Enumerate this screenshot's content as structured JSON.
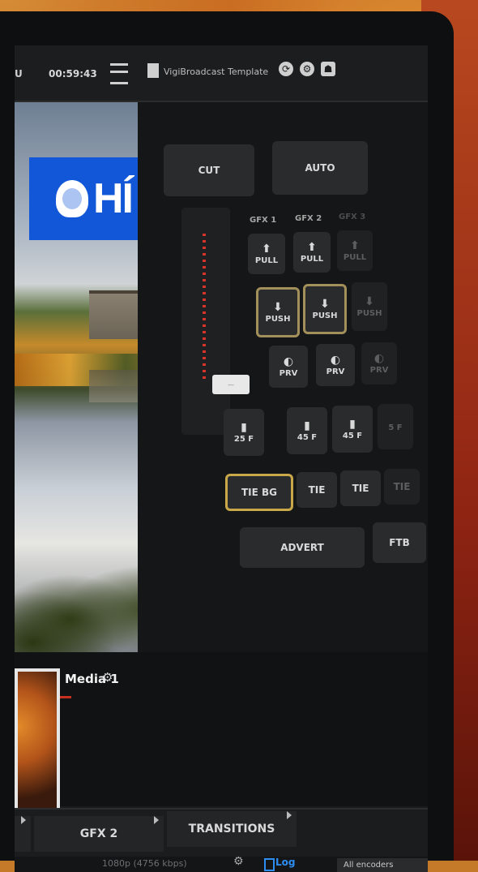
{
  "topbar": {
    "clip_label": "U",
    "timecode": "00:59:43",
    "template_name": "VigiBroadcast Template"
  },
  "preview": {
    "logo_text": "HÍ"
  },
  "controls": {
    "cut_label": "CUT",
    "auto_label": "AUTO",
    "gfx_columns": [
      "GFX 1",
      "GFX 2",
      "GFX 3"
    ],
    "pull_label": "PULL",
    "push_label": "PUSH",
    "prv_label": "PRV",
    "fader_handle_label": "—",
    "frames": [
      "25 F",
      "45 F",
      "45 F",
      "5 F"
    ],
    "tie_bg_label": "TIE BG",
    "tie_label": "TIE",
    "advert_label": "ADVERT",
    "ftb_label": "FTB"
  },
  "media": {
    "title": "Media 1"
  },
  "tabs": [
    "",
    "GFX 2",
    "TRANSITIONS"
  ],
  "bottombar": {
    "resolution": "1080p (4756 kbps)",
    "log_label": "Log",
    "encoders_label": "All encoders"
  }
}
